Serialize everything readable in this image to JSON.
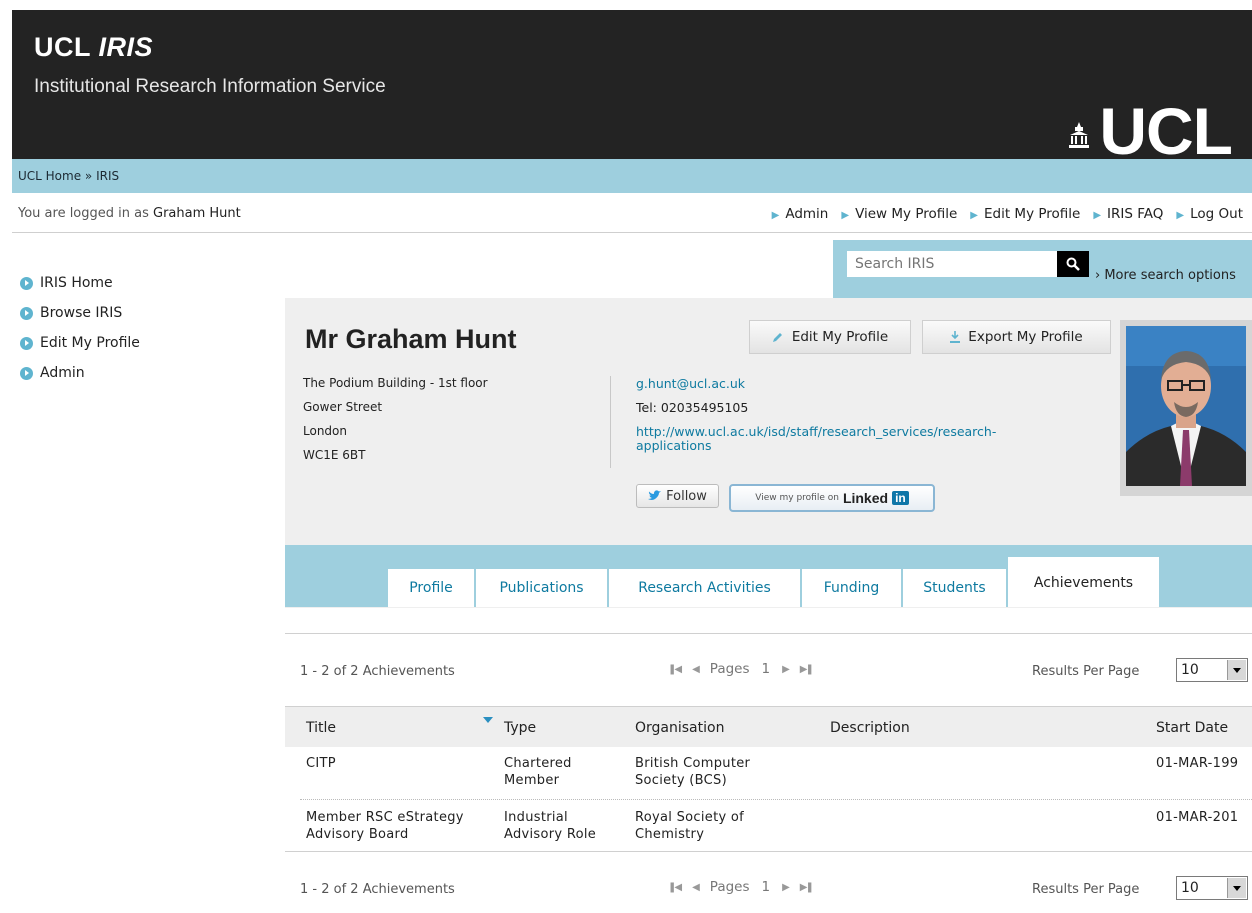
{
  "header": {
    "brand": "UCL",
    "brand_italic": "IRIS",
    "subtitle": "Institutional Research Information Service",
    "logo_text": "UCL"
  },
  "breadcrumb": "UCL Home » IRIS",
  "login": {
    "prefix": "You are logged in as",
    "user": "Graham Hunt"
  },
  "topnav": [
    "Admin",
    "View My Profile",
    "Edit My Profile",
    "IRIS FAQ",
    "Log Out"
  ],
  "sidebar": [
    "IRIS Home",
    "Browse IRIS",
    "Edit My Profile",
    "Admin"
  ],
  "search": {
    "placeholder": "Search IRIS",
    "more": "› More search options",
    "icon": "search-icon"
  },
  "profile": {
    "name": "Mr Graham Hunt",
    "address": [
      "The Podium Building - 1st floor",
      "Gower Street",
      "London",
      "WC1E 6BT"
    ],
    "email": "g.hunt@ucl.ac.uk",
    "tel": "Tel: 02035495105",
    "url_line1": "http://www.ucl.ac.uk/isd/staff/research_services/research-",
    "url_line2": "applications",
    "edit_button": "Edit My Profile",
    "export_button": "Export My Profile",
    "follow_button": "Follow",
    "linkedin_prefix": "View my profile on",
    "linkedin_word": "Linked",
    "linkedin_in": "in"
  },
  "tabs": [
    "Profile",
    "Publications",
    "Research Activities",
    "Funding",
    "Students",
    "Achievements"
  ],
  "active_tab": "Achievements",
  "pagination": {
    "count": "1 - 2  of 2 Achievements",
    "pages_label": "Pages",
    "page": "1",
    "results_label": "Results Per Page",
    "results_value": "10"
  },
  "table": {
    "columns": [
      "Title",
      "Type",
      "Organisation",
      "Description",
      "Start Date"
    ],
    "rows": [
      {
        "title": [
          "CITP",
          ""
        ],
        "type": [
          "Chartered",
          "Member"
        ],
        "org": [
          "British Computer",
          "Society (BCS)"
        ],
        "description": "",
        "start": "01-MAR-199"
      },
      {
        "title": [
          "Member RSC eStrategy",
          "Advisory Board"
        ],
        "type": [
          "Industrial",
          "Advisory Role"
        ],
        "org": [
          "Royal Society of",
          "Chemistry"
        ],
        "description": "",
        "start": "01-MAR-201"
      }
    ]
  },
  "colors": {
    "header_bg": "#232323",
    "accent": "#9ecfde",
    "link": "#0e7aa0",
    "panel": "#efefef"
  }
}
